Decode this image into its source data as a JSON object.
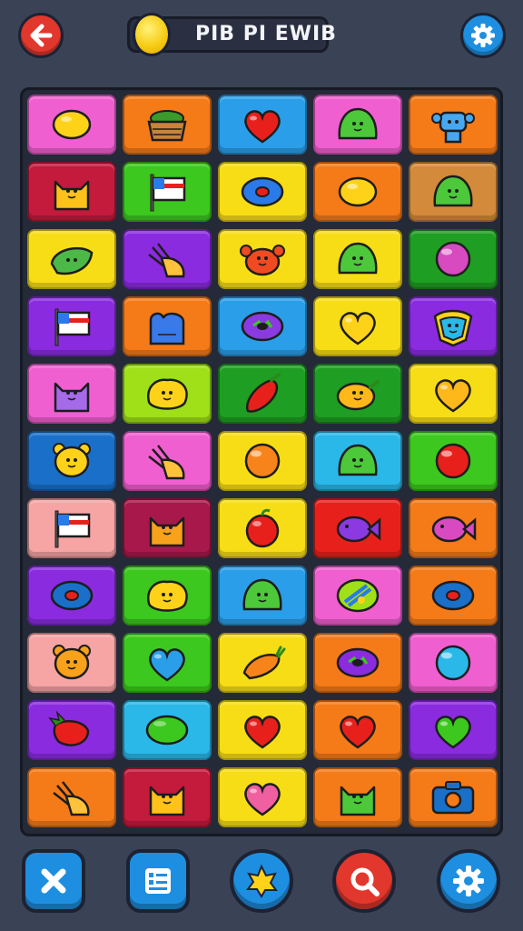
{
  "header": {
    "title": "PIB PI EWIB",
    "back_icon": "arrow-left-icon",
    "coin_icon": "coin-icon",
    "settings_icon": "gear-icon"
  },
  "colors": {
    "pink": "#f05fd0",
    "orange": "#f57a18",
    "blue": "#2a9ee8",
    "green": "#3cc81e",
    "yellow": "#f7dd16",
    "purple": "#8a2be0",
    "crimson": "#c41a3c",
    "tan": "#d38a3a",
    "lime": "#9fe018",
    "darkgreen": "#1e9e22",
    "salmon": "#f6a4a4",
    "red": "#e8201c",
    "maroon": "#a8184a",
    "navy": "#1a6fc8",
    "cyan": "#2ab8e8"
  },
  "board": {
    "rows": [
      [
        {
          "bg": "pink",
          "icon": "lemon-icon",
          "color": "#ffd21a"
        },
        {
          "bg": "orange",
          "icon": "basket-icon",
          "color": "#c8843a"
        },
        {
          "bg": "blue",
          "icon": "heart-icon",
          "color": "#e8201c"
        },
        {
          "bg": "pink",
          "icon": "slime-icon",
          "color": "#4cc83a"
        },
        {
          "bg": "orange",
          "icon": "robot-icon",
          "color": "#46a8f0"
        }
      ],
      [
        {
          "bg": "crimson",
          "icon": "cat-icon",
          "color": "#ffc21a"
        },
        {
          "bg": "green",
          "icon": "flag-icon",
          "color": "#ffffff"
        },
        {
          "bg": "yellow",
          "icon": "ring-icon",
          "color": "#2a7ae8"
        },
        {
          "bg": "orange",
          "icon": "lemon-icon",
          "color": "#ffd21a"
        },
        {
          "bg": "tan",
          "icon": "slime-icon",
          "color": "#4cc83a"
        }
      ],
      [
        {
          "bg": "yellow",
          "icon": "leaf-icon",
          "color": "#4cb848"
        },
        {
          "bg": "purple",
          "icon": "hand-icon",
          "color": "#ffc23a"
        },
        {
          "bg": "yellow",
          "icon": "crab-icon",
          "color": "#f04a22"
        },
        {
          "bg": "yellow",
          "icon": "slime-icon",
          "color": "#4cc83a"
        },
        {
          "bg": "darkgreen",
          "icon": "orb-icon",
          "color": "#d84ac0"
        }
      ],
      [
        {
          "bg": "purple",
          "icon": "flag-icon",
          "color": "#ffffff"
        },
        {
          "bg": "orange",
          "icon": "mitten-icon",
          "color": "#3a7ae8"
        },
        {
          "bg": "blue",
          "icon": "donut-icon",
          "color": "#8a3ae0"
        },
        {
          "bg": "yellow",
          "icon": "heart-icon",
          "color": "#ffd21a"
        },
        {
          "bg": "purple",
          "icon": "crest-icon",
          "color": "#2ab8e8"
        }
      ],
      [
        {
          "bg": "pink",
          "icon": "cat-icon",
          "color": "#a46ae8"
        },
        {
          "bg": "lime",
          "icon": "blob-face-icon",
          "color": "#ffd21a"
        },
        {
          "bg": "darkgreen",
          "icon": "chili-icon",
          "color": "#e8201c"
        },
        {
          "bg": "darkgreen",
          "icon": "mango-icon",
          "color": "#ffb81a"
        },
        {
          "bg": "yellow",
          "icon": "heart-icon",
          "color": "#ffb81a"
        }
      ],
      [
        {
          "bg": "navy",
          "icon": "bear-icon",
          "color": "#ffd21a"
        },
        {
          "bg": "pink",
          "icon": "hand-icon",
          "color": "#ffc23a"
        },
        {
          "bg": "yellow",
          "icon": "orb-icon",
          "color": "#f7841a"
        },
        {
          "bg": "cyan",
          "icon": "slime-icon",
          "color": "#4cc83a"
        },
        {
          "bg": "green",
          "icon": "orb-icon",
          "color": "#e8201c"
        }
      ],
      [
        {
          "bg": "salmon",
          "icon": "flag-icon",
          "color": "#ffffff"
        },
        {
          "bg": "maroon",
          "icon": "cat-icon",
          "color": "#f7a21a"
        },
        {
          "bg": "yellow",
          "icon": "apple-icon",
          "color": "#e8201c"
        },
        {
          "bg": "red",
          "icon": "fish-icon",
          "color": "#8a3ae0"
        },
        {
          "bg": "orange",
          "icon": "fish-icon",
          "color": "#d84ac0"
        }
      ],
      [
        {
          "bg": "purple",
          "icon": "ring-icon",
          "color": "#1a6fc8"
        },
        {
          "bg": "green",
          "icon": "blob-face-icon",
          "color": "#ffd21a"
        },
        {
          "bg": "blue",
          "icon": "slime-icon",
          "color": "#4cc83a"
        },
        {
          "bg": "pink",
          "icon": "plate-icon",
          "color": "#9fe018"
        },
        {
          "bg": "orange",
          "icon": "ring-icon",
          "color": "#1a6fc8"
        }
      ],
      [
        {
          "bg": "salmon",
          "icon": "bear-icon",
          "color": "#f7a21a"
        },
        {
          "bg": "green",
          "icon": "heart-icon",
          "color": "#2a9ee8"
        },
        {
          "bg": "yellow",
          "icon": "carrot-icon",
          "color": "#f7841a"
        },
        {
          "bg": "orange",
          "icon": "donut-icon",
          "color": "#8a2be0"
        },
        {
          "bg": "pink",
          "icon": "orb-icon",
          "color": "#2ab8e8"
        }
      ],
      [
        {
          "bg": "purple",
          "icon": "strawberry-icon",
          "color": "#e8201c"
        },
        {
          "bg": "cyan",
          "icon": "bean-icon",
          "color": "#3cc81e"
        },
        {
          "bg": "yellow",
          "icon": "heart-icon",
          "color": "#e8201c"
        },
        {
          "bg": "orange",
          "icon": "heart-icon",
          "color": "#e8201c"
        },
        {
          "bg": "purple",
          "icon": "heart-icon",
          "color": "#3cc81e"
        }
      ],
      [
        {
          "bg": "orange",
          "icon": "hand-icon",
          "color": "#ffc23a"
        },
        {
          "bg": "crimson",
          "icon": "cat-icon",
          "color": "#ffc21a"
        },
        {
          "bg": "yellow",
          "icon": "heart-icon",
          "color": "#f05fa0"
        },
        {
          "bg": "orange",
          "icon": "cat-icon",
          "color": "#4cc83a"
        },
        {
          "bg": "orange",
          "icon": "camera-icon",
          "color": "#1a6fc8"
        }
      ]
    ]
  },
  "bottom_bar": [
    {
      "name": "close-button",
      "icon": "close-icon",
      "bg": "#1e8fe0",
      "shape": "square"
    },
    {
      "name": "list-button",
      "icon": "list-icon",
      "bg": "#1e8fe0",
      "shape": "square"
    },
    {
      "name": "hint-button",
      "icon": "star-blob-icon",
      "bg": "#1e8fe0",
      "shape": "round"
    },
    {
      "name": "search-button",
      "icon": "search-icon",
      "bg": "#e2372c",
      "shape": "round"
    },
    {
      "name": "settings-button",
      "icon": "gear-icon",
      "bg": "#1e8fe0",
      "shape": "round"
    }
  ]
}
